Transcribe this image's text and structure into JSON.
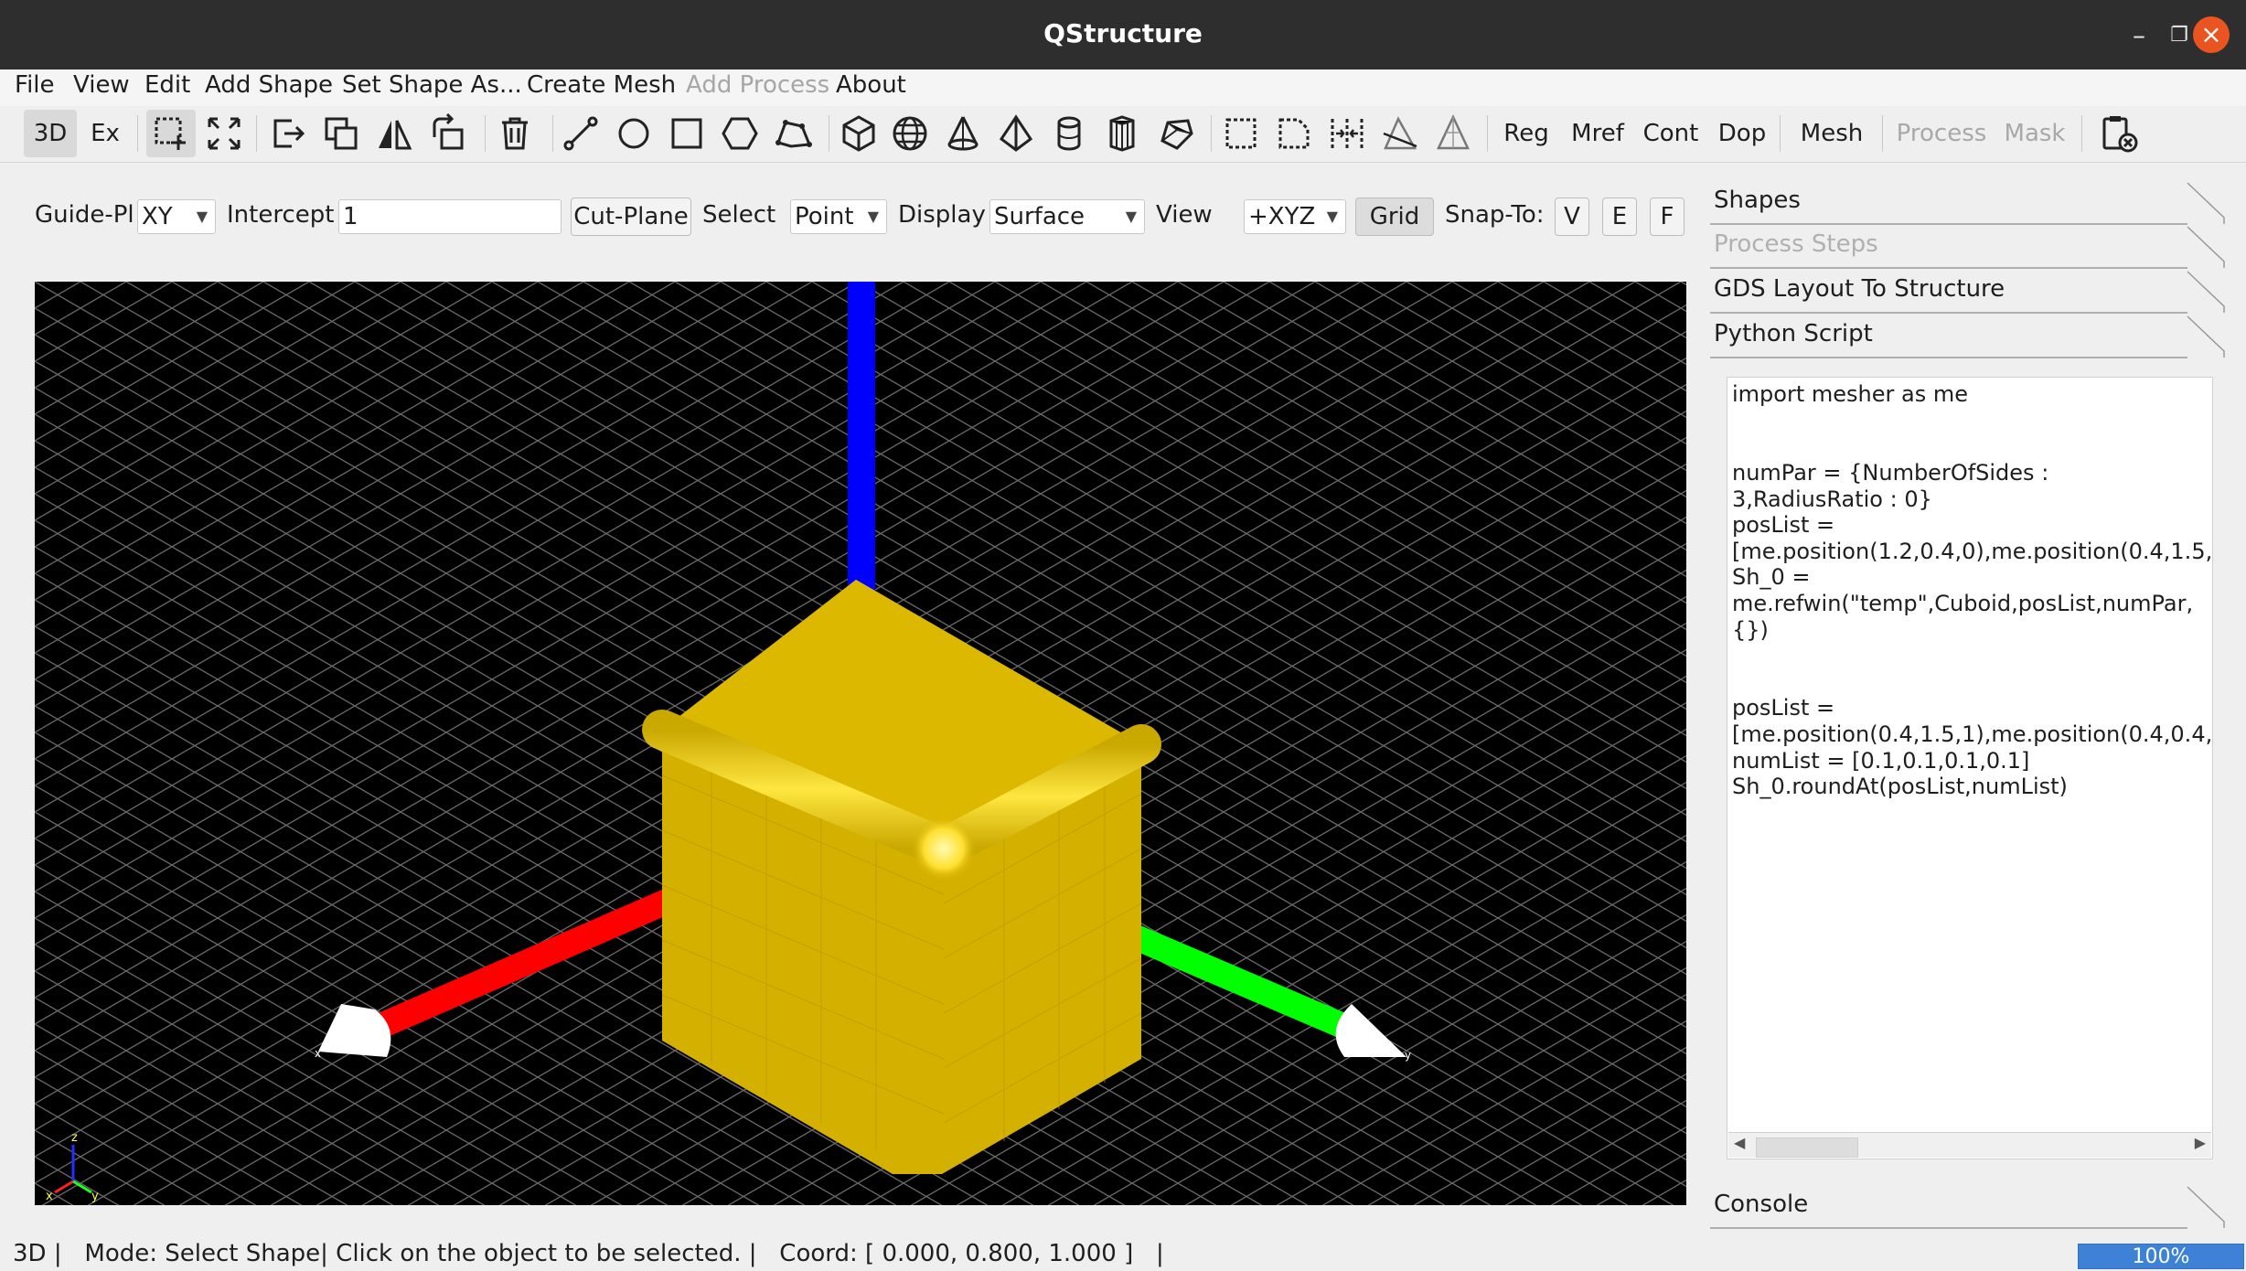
{
  "window": {
    "title": "QStructure"
  },
  "menu": {
    "items": [
      "File",
      "View",
      "Edit",
      "Add Shape",
      "Set Shape As...",
      "Create Mesh",
      "Add Process",
      "About"
    ]
  },
  "toolbar": {
    "tab_3d": "3D",
    "tab_ex": "Ex",
    "text_buttons": {
      "reg": "Reg",
      "mref": "Mref",
      "cont": "Cont",
      "dop": "Dop",
      "mesh": "Mesh",
      "process": "Process",
      "mask": "Mask"
    }
  },
  "guide": {
    "guide_label": "Guide-Pl",
    "guide_value": "XY",
    "intercept_label": "Intercept",
    "intercept_value": "1",
    "cut_plane_label": "Cut-Plane",
    "select_label": "Select",
    "select_value": "Point",
    "display_label": "Display",
    "display_value": "Surface",
    "view_label": "View",
    "view_value": "+XYZ",
    "grid_label": "Grid",
    "snap_label": "Snap-To:",
    "snap_v": "V",
    "snap_e": "E",
    "snap_f": "F"
  },
  "viewport": {
    "axis_labels": {
      "z": "z",
      "x": "x",
      "y": "y"
    },
    "colors": {
      "x_axis": "#ff0000",
      "y_axis": "#00ff00",
      "z_axis": "#0000ff",
      "cube": "#d4b000",
      "background": "#000000"
    }
  },
  "panel": {
    "tabs": [
      "Shapes",
      "Process Steps",
      "GDS Layout To Structure",
      "Python Script"
    ],
    "console": "Console",
    "script_lines": [
      "import mesher as me",
      "",
      "",
      "numPar = {NumberOfSides :",
      "3,RadiusRatio : 0}",
      "posList =",
      "[me.position(1.2,0.4,0),me.position(0.4,1.5,",
      "Sh_0 =",
      "me.refwin(\"temp\",Cuboid,posList,numPar,",
      "{})",
      "",
      "",
      "posList =",
      "[me.position(0.4,1.5,1),me.position(0.4,0.4,",
      "numList = [0.1,0.1,0.1,0.1]",
      "Sh_0.roundAt(posList,numList)"
    ]
  },
  "status": {
    "text": "3D |   Mode: Select Shape| Click on the object to be selected. |   Coord: [ 0.000, 0.800, 1.000 ]   |",
    "progress": "100%"
  }
}
